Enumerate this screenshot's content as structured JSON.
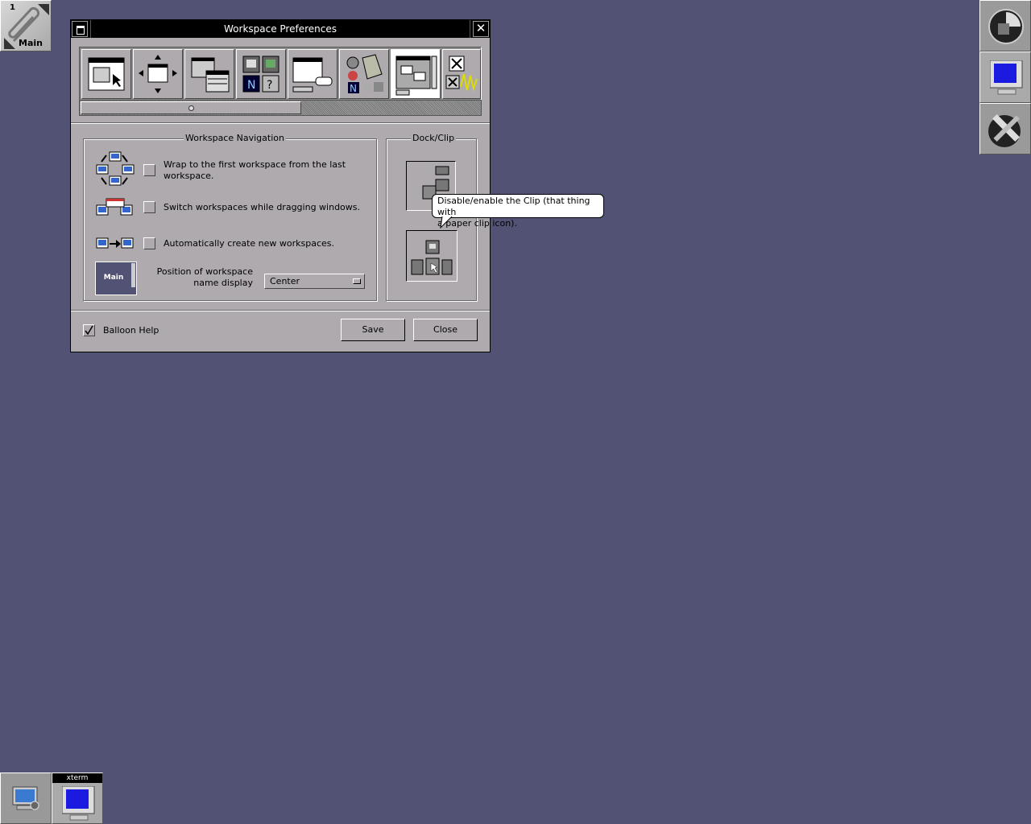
{
  "clip": {
    "workspace_number": "1",
    "workspace_name": "Main"
  },
  "window": {
    "title": "Workspace Preferences",
    "icons": [
      "window-focus-prefs-icon",
      "window-placement-prefs-icon",
      "window-attributes-prefs-icon",
      "icon-prefs-icon",
      "window-titlebar-prefs-icon",
      "appearance-prefs-icon",
      "workspace-prefs-icon",
      "misc-prefs-icon"
    ],
    "selected_icon": 6,
    "navigation": {
      "label": "Workspace Navigation",
      "wrap_label": "Wrap to the first workspace from the last workspace.",
      "switch_label": "Switch workspaces while dragging windows.",
      "autocreate_label": "Automatically create new workspaces.",
      "position_label_1": "Position of workspace",
      "position_label_2": "name display",
      "position_value": "Center",
      "preview_name": "Main"
    },
    "dockclip": {
      "label": "Dock/Clip"
    },
    "balloon": {
      "text_1": "Disable/enable the Clip (that thing with",
      "text_2": "a paper clip icon)."
    },
    "balloon_help_label": "Balloon Help",
    "balloon_help_checked": true,
    "save_label": "Save",
    "close_label": "Close"
  },
  "taskbar": {
    "xterm_title": "xterm"
  },
  "colors": {
    "desktop": "#525275",
    "panel": "#aeaaae",
    "titlebar": "#000000",
    "balloon": "#ffffff"
  }
}
